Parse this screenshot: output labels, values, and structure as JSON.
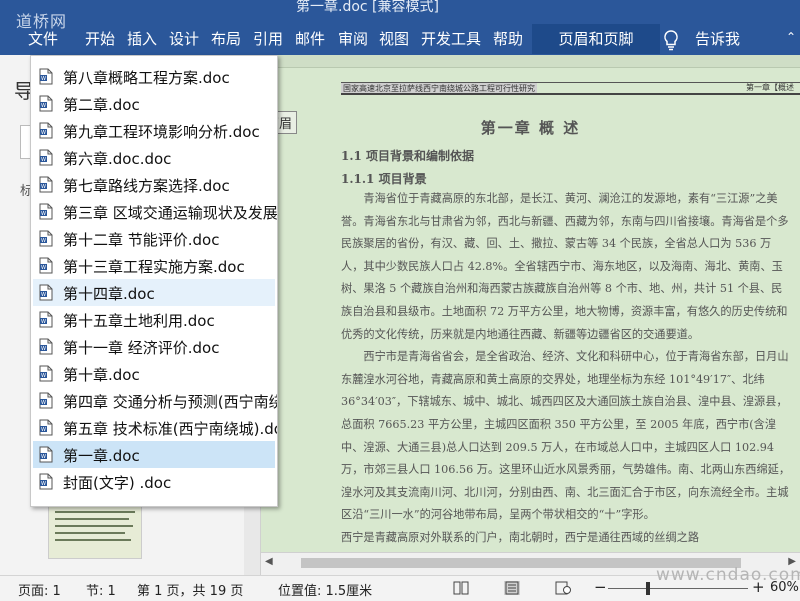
{
  "titlebar": {
    "watermark": "道桥网",
    "doc_title": "第一章.doc [兼容模式]"
  },
  "ribbon": {
    "tabs": [
      "文件",
      "开始",
      "插入",
      "设计",
      "布局",
      "引用",
      "邮件",
      "审阅",
      "视图",
      "开发工具",
      "帮助"
    ],
    "contextual_tab": "页眉和页脚",
    "tell_me": "告诉我"
  },
  "nav_pane": {
    "heading": "导",
    "label": "标"
  },
  "recent_files": [
    "第八章概略工程方案.doc",
    "第二章.doc",
    "第九章工程环境影响分析.doc",
    "第六章.doc.doc",
    "第七章路线方案选择.doc",
    "第三章 区域交通运输现状及发展",
    "第十二章 节能评价.doc",
    "第十三章工程实施方案.doc",
    "第十四章.doc",
    "第十五章土地利用.doc",
    "第十一章 经济评价.doc",
    "第十章.doc",
    "第四章 交通分析与预测(西宁南绕",
    "第五章 技术标准(西宁南绕城).doc",
    "第一章.doc",
    "封面(文字)  .doc"
  ],
  "recent_state": {
    "selected_index": 14,
    "hovered_index": 8
  },
  "document": {
    "header_left": "国家高速北京至拉萨线西宁南绕城公路工程可行性研究",
    "header_right": "第一章【概述",
    "header_tag": "页眉",
    "chapter_title": "第一章  概  述",
    "section_1": "1.1 项目背景和编制依据",
    "section_1_1": "1.1.1 项目背景",
    "paragraph_1": "青海省位于青藏高原的东北部，是长江、黄河、澜沧江的发源地，素有“三江源”之美誉。青海省东北与甘肃省为邻，西北与新疆、西藏为邻，东南与四川省接壤。青海省是个多民族聚居的省份，有汉、藏、回、土、撒拉、蒙古等 34 个民族，全省总人口为 536 万人，其中少数民族人口占 42.8%。全省辖西宁市、海东地区，以及海南、海北、黄南、玉树、果洛 5 个藏族自治州和海西蒙古族藏族自治州等 8 个市、地、州，共计 51 个县、民族自治县和县级市。土地面积 72 万平方公里，地大物博，资源丰富，有悠久的历史传统和优秀的文化传统，历来就是内地通往西藏、新疆等边疆省区的交通要道。",
    "paragraph_2": "西宁市是青海省省会，是全省政治、经济、文化和科研中心，位于青海省东部，日月山东麓湟水河谷地，青藏高原和黄土高原的交界处，地理坐标为东经 101°49′17″、北纬 36°34′03″，下辖城东、城中、城北、城西四区及大通回族土族自治县、湟中县、湟源县，总面积 7665.23 平方公里，主城四区面积 350 平方公里，至 2005 年底，西宁市(含湟中、湟源、大通三县)总人口达到 209.5 万人，在市域总人口中，主城四区人口 102.94 万，市郊三县人口 106.56 万。这里环山近水风景秀丽，气势雄伟。南、北两山东西绵延，湟水河及其支流南川河、北川河，分别由西、南、北三面汇合于市区，向东流经全市。主城区沿“三川一水”的河谷地带布局，呈两个带状相交的“十”字形。",
    "paragraph_3": "西宁是青藏高原对外联系的门户，南北朝时，西宁是通往西域的丝绸之路"
  },
  "status_bar": {
    "page": "页面: 1",
    "section": "节: 1",
    "page_count": "第 1 页，共 19 页",
    "position": "位置值: 1.5厘米",
    "zoom_minus": "−",
    "zoom_plus": "+",
    "zoom": "60%",
    "zoom_level": 0.6
  },
  "site_watermark": "www.cndao.com",
  "colors": {
    "ribbon": "#2b579a",
    "document_bg": "#d8e8cf",
    "selection": "#cce4f7"
  }
}
